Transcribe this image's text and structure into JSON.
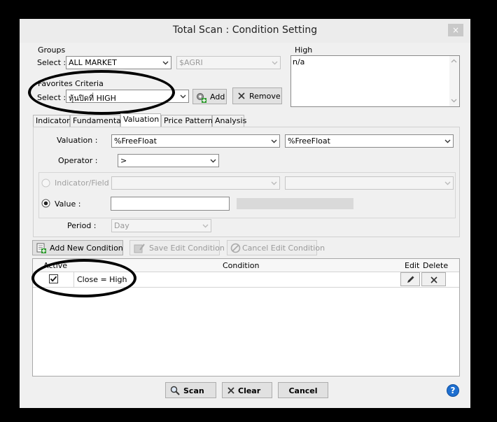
{
  "window": {
    "title": "Total Scan : Condition Setting",
    "close_glyph": "×"
  },
  "groups": {
    "legend": "Groups",
    "select_label": "Select :",
    "market_value": "ALL MARKET",
    "sub_value": "$AGRI"
  },
  "favorites": {
    "legend": "Favorites Criteria",
    "select_label": "Select :",
    "value": "หุ้นปิดที่ HIGH",
    "add_label": "Add",
    "remove_label": "Remove"
  },
  "high_box": {
    "legend": "High",
    "text": "n/a"
  },
  "tabs": [
    "Indicator",
    "Fundamental",
    "Valuation",
    "Price Pattern",
    "Analysis"
  ],
  "active_tab": "Valuation",
  "valuation": {
    "valuation_label": "Valuation :",
    "valuation_left": "%FreeFloat",
    "valuation_right": "%FreeFloat",
    "operator_label": "Operator :",
    "operator_value": ">",
    "indicator_label": "Indicator/Field :",
    "value_label": "Value :",
    "value_input": "",
    "period_label": "Period :",
    "period_value": "Day"
  },
  "actions": {
    "add_new": "Add New Condition",
    "save_edit": "Save Edit Condition",
    "cancel_edit": "Cancel Edit Condition"
  },
  "grid": {
    "headers": {
      "active": "Active",
      "condition": "Condition",
      "edit": "Edit",
      "delete": "Delete"
    },
    "rows": [
      {
        "active": true,
        "condition": "Close = High"
      }
    ]
  },
  "footer": {
    "scan": "Scan",
    "clear": "Clear",
    "cancel": "Cancel",
    "help": "?"
  },
  "colors": {
    "window_bg": "#f0f0f0",
    "screen_bg": "#000000",
    "help_blue": "#1e6fd0"
  }
}
